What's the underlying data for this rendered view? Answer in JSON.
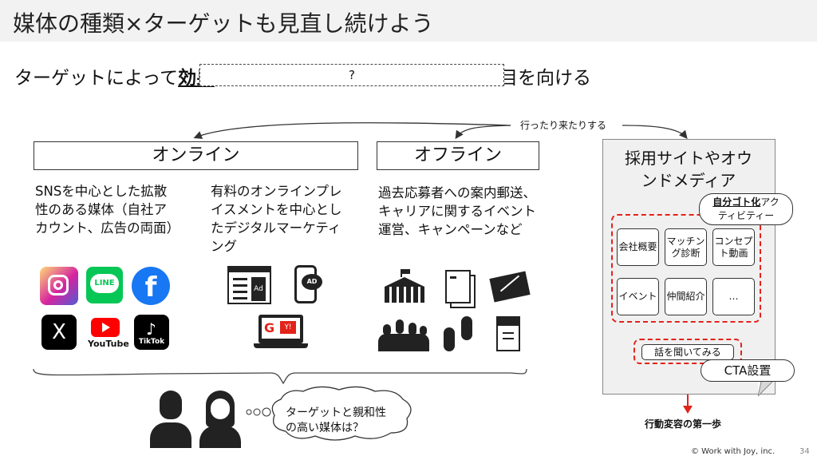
{
  "title": "媒体の種類×ターゲットも見直し続けよう",
  "subtitle": {
    "pre": "ターゲットによって",
    "underline": "効果",
    "post": "目を向ける",
    "hidden_placeholder": "?"
  },
  "connector_label": "行ったり来たりする",
  "online": {
    "header": "オンライン",
    "left_text": "SNSを中心とした拡散性のある媒体（自社アカウント、広告の両面）",
    "right_text": "有料のオンラインプレイスメントを中心としたデジタルマーケティング",
    "icons": [
      "instagram-icon",
      "line-icon",
      "facebook-icon",
      "x-icon",
      "youtube-icon",
      "tiktok-icon",
      "web-ad-icon",
      "mobile-ad-icon",
      "search-ad-icon"
    ],
    "icon_labels": {
      "line": "LINE",
      "facebook": "f",
      "x": "X",
      "youtube": "You",
      "youtube2": "Tube",
      "tiktok": "TikTok",
      "ad": "Ad",
      "ad2": "AD",
      "google": "G",
      "yahoo": "Y!"
    }
  },
  "offline": {
    "header": "オフライン",
    "text": "過去応募者への案内郵送、キャリアに関するイベント運営、キャンペーンなど",
    "icons": [
      "building-icon",
      "documents-icon",
      "mail-icon",
      "crowd-icon",
      "footprints-icon",
      "booklet-icon"
    ]
  },
  "owned_media": {
    "title_line1": "採用サイトやオウ",
    "title_line2": "ンドメディア",
    "activity_bubble_underline": "自分ゴト化",
    "activity_bubble_line1_rest": "アク",
    "activity_bubble_line2": "ティビティー",
    "cards": [
      "会社概要",
      "マッチング診断",
      "コンセプト動画",
      "イベント",
      "仲間紹介",
      "…"
    ],
    "cta_button": "話を聞いてみる",
    "cta_label": "CTA設置",
    "arrow_label": "行動変容の第一歩"
  },
  "persona_bubble": {
    "line1": "ターゲットと親和性",
    "line2": "の高い媒体は？"
  },
  "footer": {
    "copyright": "© Work with Joy, inc.",
    "page_number": "34"
  },
  "colors": {
    "accent_red": "#e2231a",
    "instagram": "#d6249f",
    "line": "#06c755",
    "facebook": "#1877f2",
    "youtube": "#ff0000"
  }
}
